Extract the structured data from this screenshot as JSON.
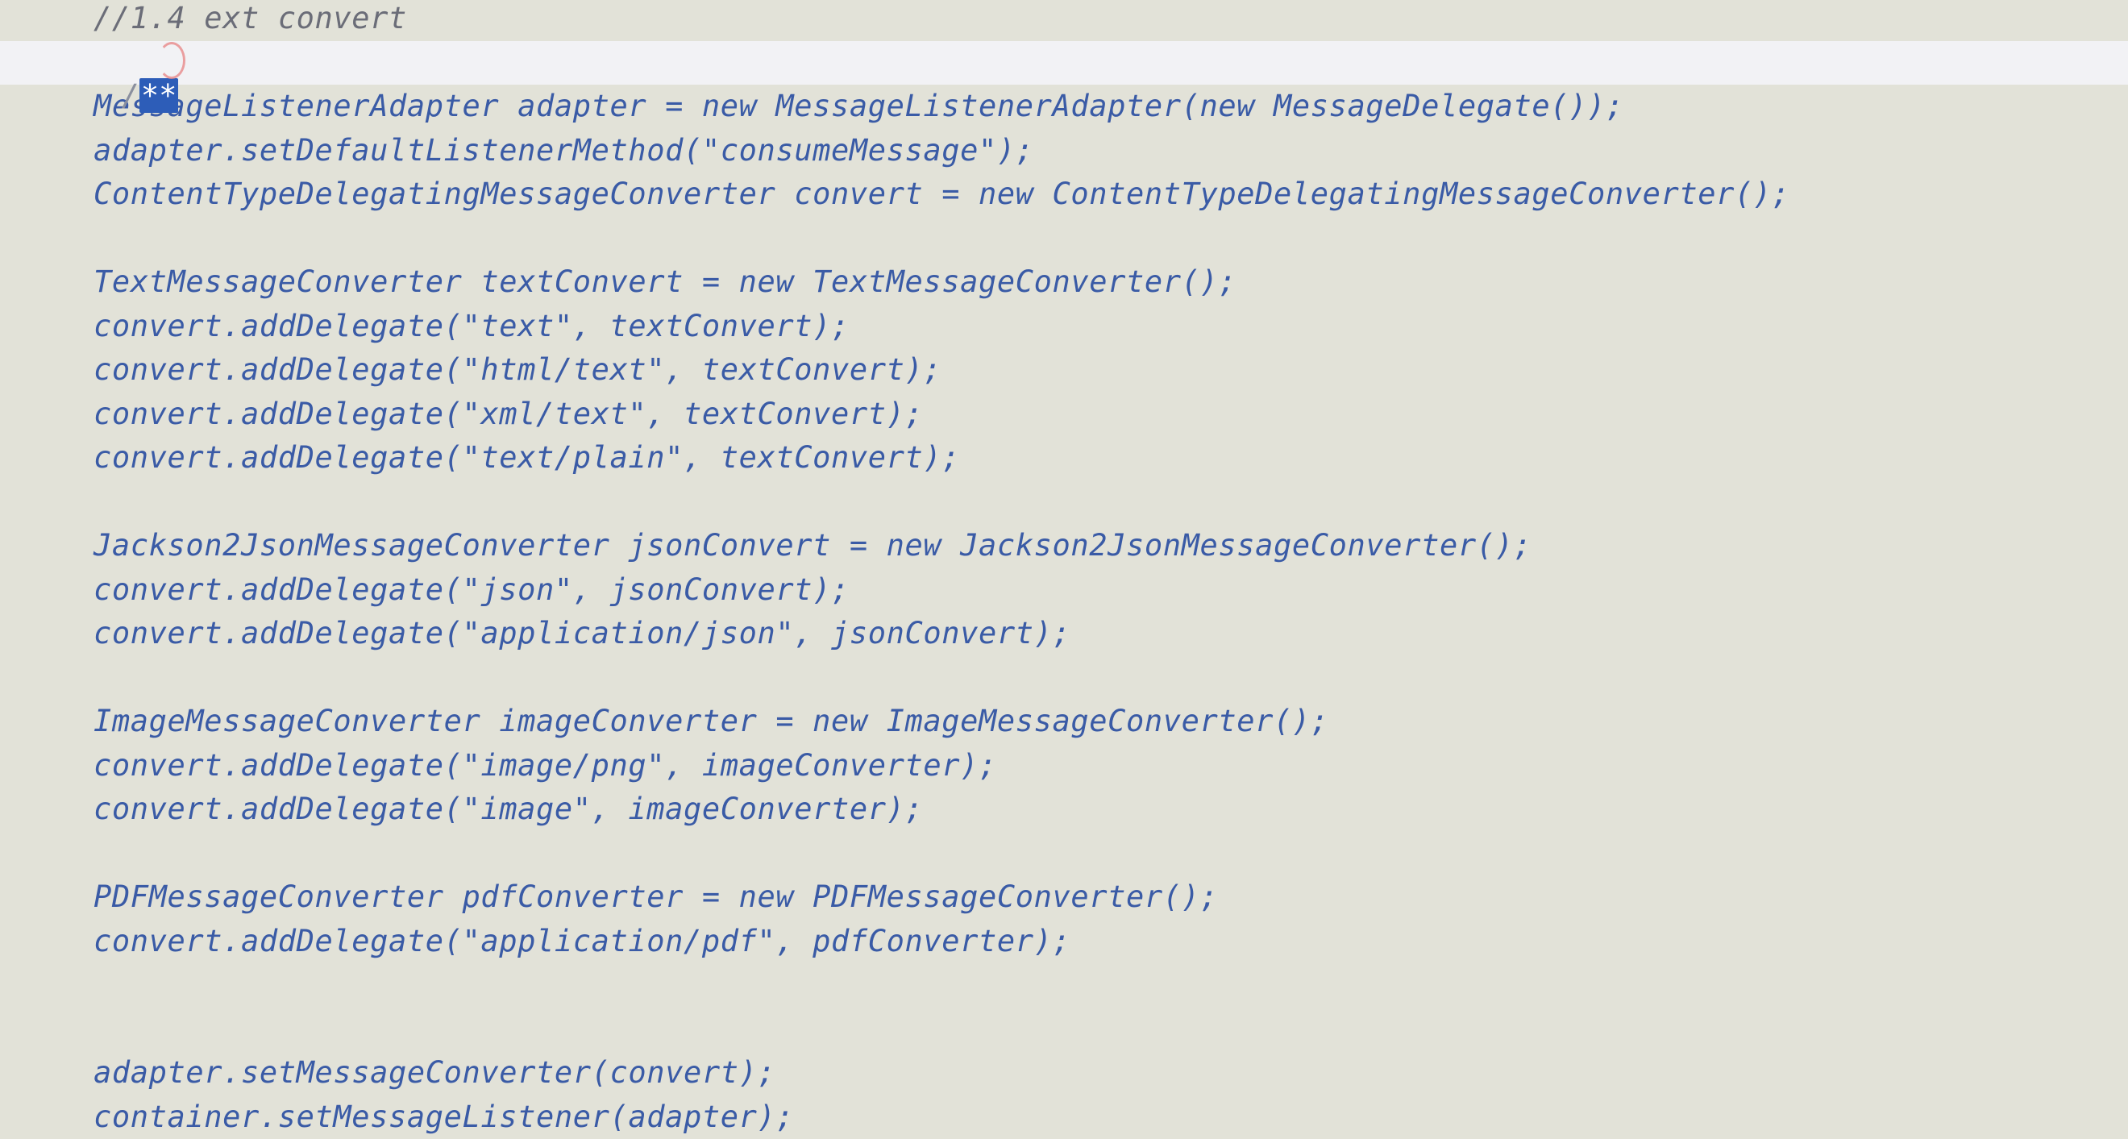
{
  "editor": {
    "lines": [
      {
        "text": "//1.4 ext convert",
        "kind": "comment"
      },
      {
        "text": "",
        "kind": "current"
      },
      {
        "text": "MessageListenerAdapter adapter = new MessageListenerAdapter(new MessageDelegate());",
        "kind": "code"
      },
      {
        "text": "adapter.setDefaultListenerMethod(\"consumeMessage\");",
        "kind": "code"
      },
      {
        "text": "ContentTypeDelegatingMessageConverter convert = new ContentTypeDelegatingMessageConverter();",
        "kind": "code"
      },
      {
        "text": "",
        "kind": "blank"
      },
      {
        "text": "TextMessageConverter textConvert = new TextMessageConverter();",
        "kind": "code"
      },
      {
        "text": "convert.addDelegate(\"text\", textConvert);",
        "kind": "code"
      },
      {
        "text": "convert.addDelegate(\"html/text\", textConvert);",
        "kind": "code"
      },
      {
        "text": "convert.addDelegate(\"xml/text\", textConvert);",
        "kind": "code"
      },
      {
        "text": "convert.addDelegate(\"text/plain\", textConvert);",
        "kind": "code"
      },
      {
        "text": "",
        "kind": "blank"
      },
      {
        "text": "Jackson2JsonMessageConverter jsonConvert = new Jackson2JsonMessageConverter();",
        "kind": "code"
      },
      {
        "text": "convert.addDelegate(\"json\", jsonConvert);",
        "kind": "code"
      },
      {
        "text": "convert.addDelegate(\"application/json\", jsonConvert);",
        "kind": "code"
      },
      {
        "text": "",
        "kind": "blank"
      },
      {
        "text": "ImageMessageConverter imageConverter = new ImageMessageConverter();",
        "kind": "code"
      },
      {
        "text": "convert.addDelegate(\"image/png\", imageConverter);",
        "kind": "code"
      },
      {
        "text": "convert.addDelegate(\"image\", imageConverter);",
        "kind": "code"
      },
      {
        "text": "",
        "kind": "blank"
      },
      {
        "text": "PDFMessageConverter pdfConverter = new PDFMessageConverter();",
        "kind": "code"
      },
      {
        "text": "convert.addDelegate(\"application/pdf\", pdfConverter);",
        "kind": "code"
      },
      {
        "text": "",
        "kind": "blank"
      },
      {
        "text": "",
        "kind": "blank"
      },
      {
        "text": "adapter.setMessageConverter(convert);",
        "kind": "code"
      },
      {
        "text": "container.setMessageListener(adapter);",
        "kind": "code"
      }
    ],
    "cursor_line": {
      "slash": "/",
      "selected": "**"
    }
  },
  "colors": {
    "background": "#e2e2d8",
    "current_line": "#f2f2f5",
    "code_text": "#3a5ba6",
    "comment_text": "#6b6d78",
    "selection": "#2d5db8"
  }
}
